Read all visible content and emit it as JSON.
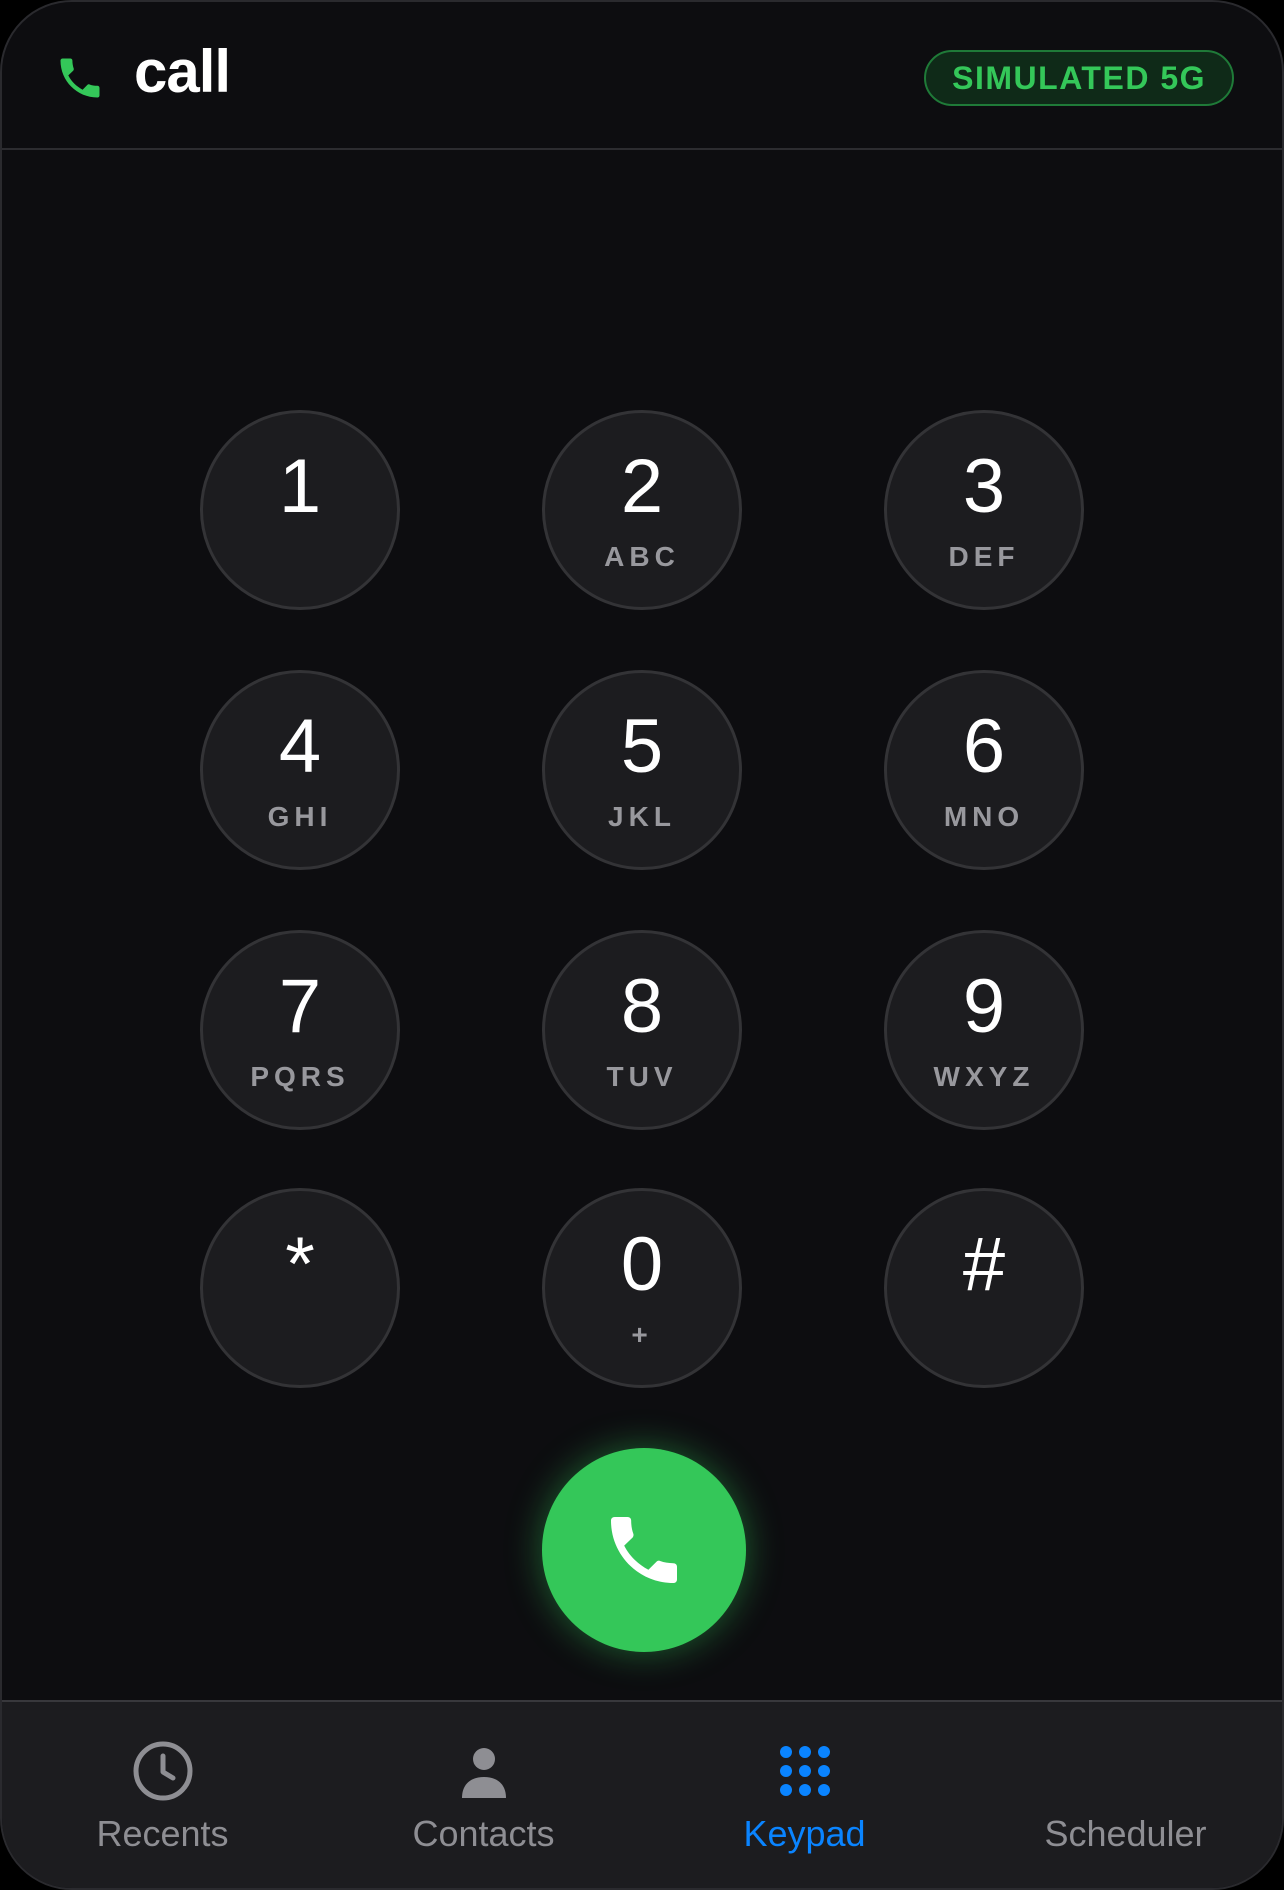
{
  "app": {
    "title": "call",
    "badge": "SIMULATED 5G",
    "accent_color": "#34c759",
    "active_tab_color": "#0a84ff"
  },
  "keypad": {
    "keys": [
      {
        "digit": "1",
        "letters": ""
      },
      {
        "digit": "2",
        "letters": "ABC"
      },
      {
        "digit": "3",
        "letters": "DEF"
      },
      {
        "digit": "4",
        "letters": "GHI"
      },
      {
        "digit": "5",
        "letters": "JKL"
      },
      {
        "digit": "6",
        "letters": "MNO"
      },
      {
        "digit": "7",
        "letters": "PQRS"
      },
      {
        "digit": "8",
        "letters": "TUV"
      },
      {
        "digit": "9",
        "letters": "WXYZ"
      },
      {
        "digit": "*",
        "letters": ""
      },
      {
        "digit": "0",
        "letters": "+"
      },
      {
        "digit": "#",
        "letters": ""
      }
    ],
    "call_button_icon": "phone-icon"
  },
  "tabbar": {
    "tabs": [
      {
        "label": "Recents",
        "icon": "clock-icon",
        "active": false
      },
      {
        "label": "Contacts",
        "icon": "person-icon",
        "active": false
      },
      {
        "label": "Keypad",
        "icon": "keypad-grid-icon",
        "active": true
      },
      {
        "label": "Scheduler",
        "icon": "",
        "active": false
      }
    ]
  }
}
